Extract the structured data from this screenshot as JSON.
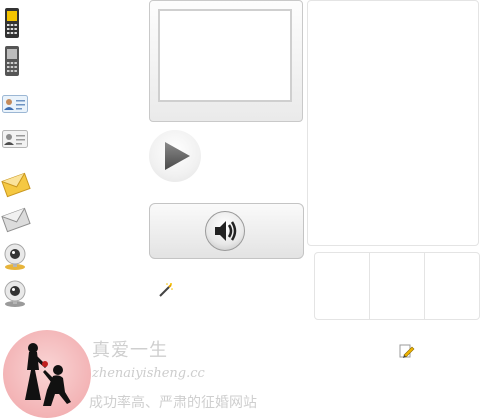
{
  "watermark": {
    "title": "真爱一生",
    "url": "zhenaiyisheng.cc",
    "slogan": "成功率高、严肃的征婚网站"
  },
  "icons": [
    "mobile-phone-yellow-icon",
    "mobile-phone-gray-icon",
    "contact-card-blue-icon",
    "contact-card-gray-icon",
    "envelope-yellow-icon",
    "envelope-gray-icon",
    "webcam-icon",
    "webcam-gray-icon",
    "magic-wand-icon",
    "edit-note-icon",
    "play-icon",
    "speaker-icon"
  ],
  "colors": {
    "watermark_pink": "#f3b3b5",
    "phone_yellow": "#f4c400",
    "envelope_yellow": "#f5c842"
  }
}
